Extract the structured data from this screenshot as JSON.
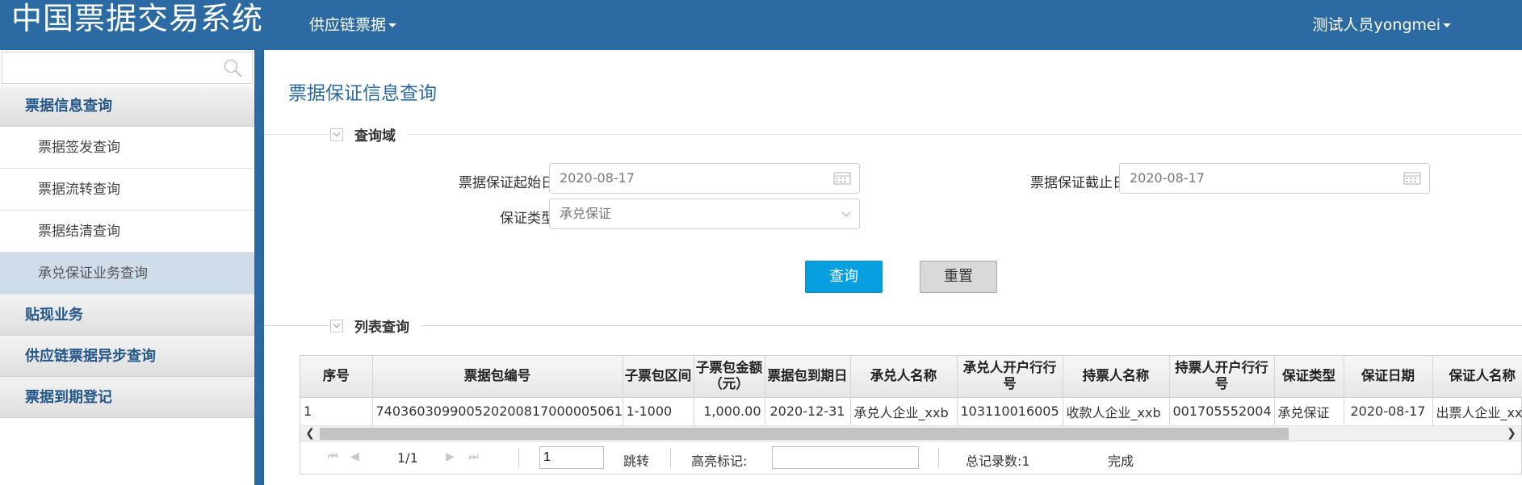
{
  "header": {
    "app_title": "中国票据交易系统",
    "nav_label": "供应链票据",
    "user_label": "测试人员yongmei"
  },
  "sidebar": {
    "search_placeholder": "",
    "groups": [
      {
        "label": "票据信息查询",
        "items": [
          "票据签发查询",
          "票据流转查询",
          "票据结清查询",
          "承兑保证业务查询"
        ]
      },
      {
        "label": "贴现业务"
      },
      {
        "label": "供应链票据异步查询"
      },
      {
        "label": "票据到期登记"
      }
    ],
    "active_item": "承兑保证业务查询"
  },
  "page": {
    "title": "票据保证信息查询",
    "query_section_title": "查询域",
    "list_section_title": "列表查询"
  },
  "form": {
    "start_date_label": "票据保证起始日",
    "start_date_value": "2020-08-17",
    "end_date_label": "票据保证截止日",
    "end_date_value": "2020-08-17",
    "type_label": "保证类型",
    "type_value": "承兑保证",
    "query_button": "查询",
    "reset_button": "重置"
  },
  "table": {
    "columns": [
      "序号",
      "票据包编号",
      "子票包区间",
      "子票包金额（元）",
      "票据包到期日",
      "承兑人名称",
      "承兑人开户行行号",
      "持票人名称",
      "持票人开户行行号",
      "保证类型",
      "保证日期",
      "保证人名称"
    ],
    "rows": [
      [
        "1",
        "740360309900520200817000005061",
        "1-1000",
        "1,000.00",
        "2020-12-31",
        "承兑人企业_xxb",
        "103110016005",
        "收款人企业_xxb",
        "001705552004",
        "承兑保证",
        "2020-08-17",
        "出票人企业_xxb"
      ]
    ]
  },
  "pager": {
    "page_info": "1/1",
    "page_input": "1",
    "goto_label": "跳转",
    "highlight_label": "高亮标记:",
    "highlight_value": "",
    "total_label": "总记录数:1",
    "status": "完成"
  }
}
